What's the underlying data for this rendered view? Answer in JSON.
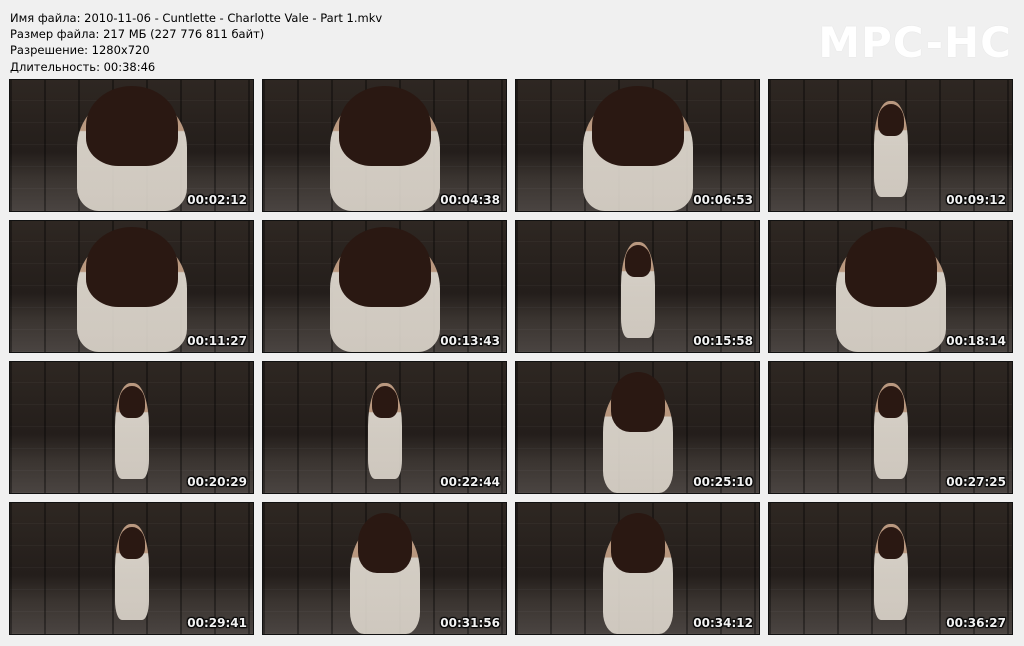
{
  "info": {
    "filename": "Имя файла: 2010-11-06 - Cuntlette - Charlotte Vale - Part 1.mkv",
    "filesize": "Размер файла: 217 МБ (227 776 811 байт)",
    "resolution": "Разрешение: 1280x720",
    "duration": "Длительность: 00:38:46"
  },
  "logo": "MPC-HC",
  "thumbnails": [
    {
      "time": "00:02:12",
      "shot": "close"
    },
    {
      "time": "00:04:38",
      "shot": "close"
    },
    {
      "time": "00:06:53",
      "shot": "close"
    },
    {
      "time": "00:09:12",
      "shot": "far"
    },
    {
      "time": "00:11:27",
      "shot": "close"
    },
    {
      "time": "00:13:43",
      "shot": "close"
    },
    {
      "time": "00:15:58",
      "shot": "far"
    },
    {
      "time": "00:18:14",
      "shot": "close"
    },
    {
      "time": "00:20:29",
      "shot": "far"
    },
    {
      "time": "00:22:44",
      "shot": "far"
    },
    {
      "time": "00:25:10",
      "shot": "mid"
    },
    {
      "time": "00:27:25",
      "shot": "far"
    },
    {
      "time": "00:29:41",
      "shot": "far"
    },
    {
      "time": "00:31:56",
      "shot": "mid"
    },
    {
      "time": "00:34:12",
      "shot": "mid"
    },
    {
      "time": "00:36:27",
      "shot": "far"
    }
  ]
}
